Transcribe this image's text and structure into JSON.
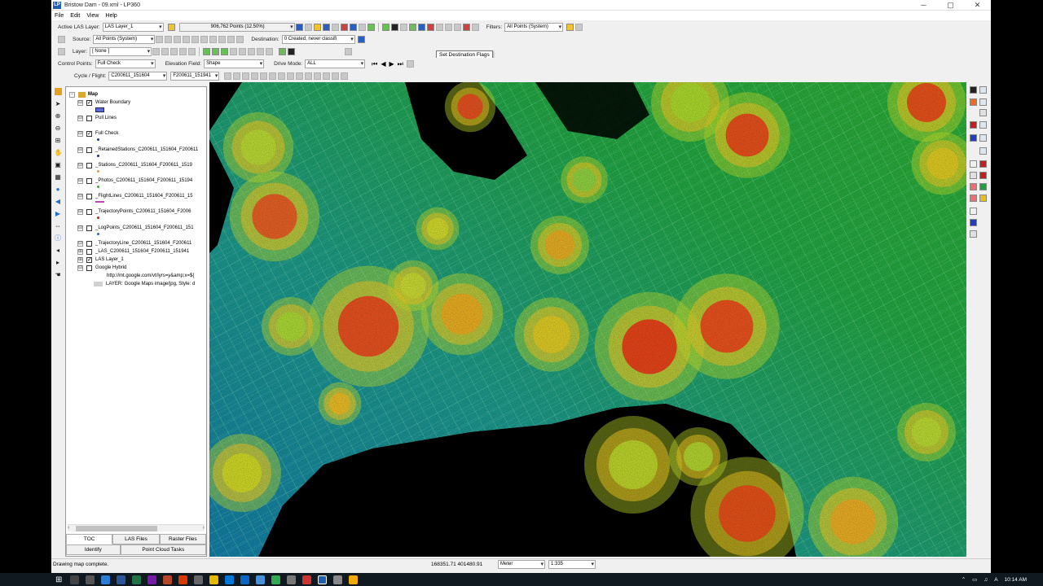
{
  "window": {
    "title": "Bristow Dam - 09.xml - LP360",
    "app_badge": "LP",
    "controls": [
      "─",
      "▢",
      "✕"
    ]
  },
  "menu": [
    "File",
    "Edit",
    "View",
    "Help"
  ],
  "toolbar1": {
    "active_layer_label": "Active LAS Layer:",
    "active_layer_value": "LAS Layer_1",
    "points_readout": "906,762 Points (12.50%)",
    "filters_label": "Filters:",
    "filters_value": "All Points (System)"
  },
  "toolbar2": {
    "source_label": "Source:",
    "source_value": "All Points (System)",
    "destination_label": "Destination:",
    "destination_value": "0  Created, never classifi"
  },
  "toolbar3": {
    "layer_label": "Layer:",
    "layer_value": "[ None ]",
    "tooltip": "Set Destination Flags"
  },
  "toolbar4": {
    "control_points_label": "Control Points:",
    "control_points_value": "Full Check",
    "elevation_field_label": "Elevation Field:",
    "elevation_field_value": "Shape",
    "drive_mode_label": "Drive Mode:",
    "drive_mode_value": "ALL"
  },
  "toolbar5": {
    "cycle_label": "Cycle / Flight:",
    "cycle_value": "C200611_151604",
    "flight_value": "F200611_151941"
  },
  "toc": {
    "root": "Map",
    "items": [
      {
        "label": "Water Boundary",
        "checked": true,
        "expander": "⊟",
        "swatch": "#5b6bdc"
      },
      {
        "label": "Pull Lines",
        "checked": false,
        "expander": "⊟",
        "swatch": ""
      },
      {
        "label": "Full Check",
        "checked": true,
        "expander": "⊟",
        "swatch": "#2233aa"
      },
      {
        "label": "_RetainedStations_C200611_151604_F200611",
        "checked": false,
        "expander": "⊟",
        "swatch": "#1a2a8a"
      },
      {
        "label": "_Stations_C200611_151604_F200611_1519",
        "checked": false,
        "expander": "⊟",
        "swatch": "#e89a3a"
      },
      {
        "label": "_Photos_C200611_151604_F200611_15194",
        "checked": false,
        "expander": "⊟",
        "swatch": "#28b028"
      },
      {
        "label": "_FlightLines_C200611_151604_F200611_15",
        "checked": false,
        "expander": "⊟",
        "swatch": "#c040c0"
      },
      {
        "label": "_TrajectoryPoints_C200611_151604_F2006",
        "checked": false,
        "expander": "⊟",
        "swatch": "#d02020"
      },
      {
        "label": "_LogPoints_C200611_151604_F200611_151",
        "checked": false,
        "expander": "⊟",
        "swatch": "#2266dd"
      },
      {
        "label": "_TrajectoryLine_C200611_151604_F200611",
        "checked": false,
        "expander": "⊟",
        "swatch": ""
      },
      {
        "label": "_LAS_C200611_151604_F200611_151941",
        "checked": false,
        "expander": "⊞",
        "swatch": ""
      },
      {
        "label": "LAS Layer_1",
        "checked": true,
        "expander": "⊞",
        "swatch": ""
      },
      {
        "label": "Google Hybrid",
        "checked": false,
        "expander": "⊟",
        "swatch": ""
      }
    ],
    "sublines": [
      "http://mt.google.com/vt/lyrs=y&amp;x=${",
      "LAYER: Google Maps image/jpg, Style: d"
    ],
    "tabs_row1": [
      "TOC",
      "LAS Files",
      "Raster Files"
    ],
    "tabs_row2": [
      "Identify",
      "Point Cloud Tasks"
    ]
  },
  "status": {
    "message": "Drawing map complete.",
    "coords": "168351.71 401480.91",
    "units": "Meter",
    "scale": "1:335"
  },
  "taskbar": {
    "time": "10:14 AM",
    "start_icon": "⊞",
    "tray_icons": [
      "⌃",
      "▭",
      "♫",
      "A"
    ]
  },
  "colors": {
    "pc_low": "#1fa6d6",
    "pc_mid": "#2fd05a",
    "pc_high": "#e8d020",
    "pc_top": "#e02818"
  }
}
